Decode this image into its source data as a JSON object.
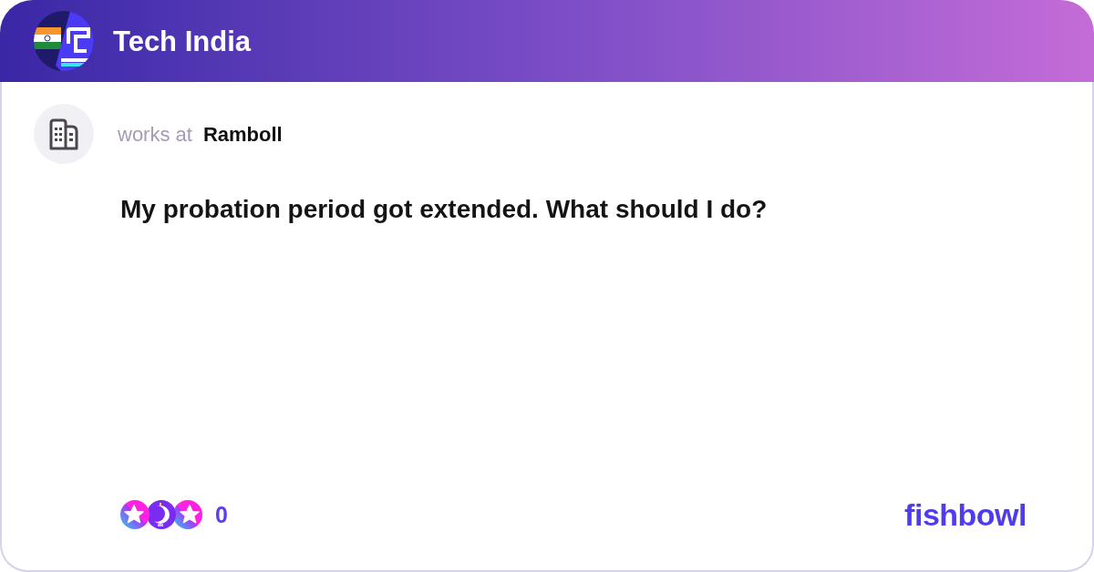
{
  "header": {
    "title": "Tech India"
  },
  "author": {
    "label": "works at",
    "company": "Ramboll"
  },
  "post": {
    "text": "My probation period got extended. What should I do?"
  },
  "footer": {
    "reaction_count": "0",
    "brand": "fishbowl"
  }
}
